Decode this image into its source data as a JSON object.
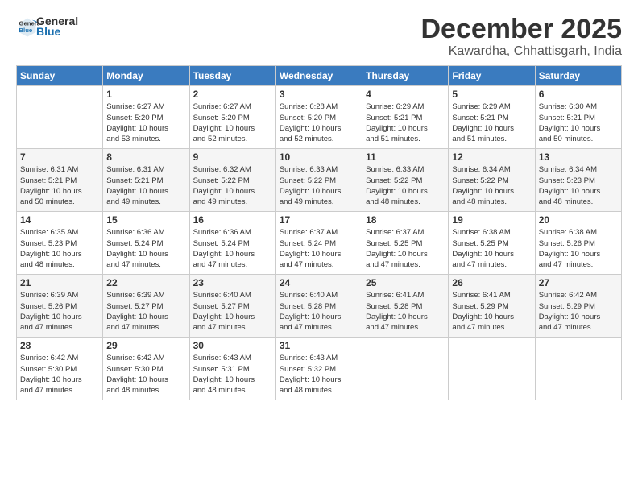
{
  "logo": {
    "line1": "General",
    "line2": "Blue"
  },
  "title": "December 2025",
  "location": "Kawardha, Chhattisgarh, India",
  "days_of_week": [
    "Sunday",
    "Monday",
    "Tuesday",
    "Wednesday",
    "Thursday",
    "Friday",
    "Saturday"
  ],
  "weeks": [
    [
      {
        "day": "",
        "info": ""
      },
      {
        "day": "1",
        "info": "Sunrise: 6:27 AM\nSunset: 5:20 PM\nDaylight: 10 hours\nand 53 minutes."
      },
      {
        "day": "2",
        "info": "Sunrise: 6:27 AM\nSunset: 5:20 PM\nDaylight: 10 hours\nand 52 minutes."
      },
      {
        "day": "3",
        "info": "Sunrise: 6:28 AM\nSunset: 5:20 PM\nDaylight: 10 hours\nand 52 minutes."
      },
      {
        "day": "4",
        "info": "Sunrise: 6:29 AM\nSunset: 5:21 PM\nDaylight: 10 hours\nand 51 minutes."
      },
      {
        "day": "5",
        "info": "Sunrise: 6:29 AM\nSunset: 5:21 PM\nDaylight: 10 hours\nand 51 minutes."
      },
      {
        "day": "6",
        "info": "Sunrise: 6:30 AM\nSunset: 5:21 PM\nDaylight: 10 hours\nand 50 minutes."
      }
    ],
    [
      {
        "day": "7",
        "info": "Sunrise: 6:31 AM\nSunset: 5:21 PM\nDaylight: 10 hours\nand 50 minutes."
      },
      {
        "day": "8",
        "info": "Sunrise: 6:31 AM\nSunset: 5:21 PM\nDaylight: 10 hours\nand 49 minutes."
      },
      {
        "day": "9",
        "info": "Sunrise: 6:32 AM\nSunset: 5:22 PM\nDaylight: 10 hours\nand 49 minutes."
      },
      {
        "day": "10",
        "info": "Sunrise: 6:33 AM\nSunset: 5:22 PM\nDaylight: 10 hours\nand 49 minutes."
      },
      {
        "day": "11",
        "info": "Sunrise: 6:33 AM\nSunset: 5:22 PM\nDaylight: 10 hours\nand 48 minutes."
      },
      {
        "day": "12",
        "info": "Sunrise: 6:34 AM\nSunset: 5:22 PM\nDaylight: 10 hours\nand 48 minutes."
      },
      {
        "day": "13",
        "info": "Sunrise: 6:34 AM\nSunset: 5:23 PM\nDaylight: 10 hours\nand 48 minutes."
      }
    ],
    [
      {
        "day": "14",
        "info": "Sunrise: 6:35 AM\nSunset: 5:23 PM\nDaylight: 10 hours\nand 48 minutes."
      },
      {
        "day": "15",
        "info": "Sunrise: 6:36 AM\nSunset: 5:24 PM\nDaylight: 10 hours\nand 47 minutes."
      },
      {
        "day": "16",
        "info": "Sunrise: 6:36 AM\nSunset: 5:24 PM\nDaylight: 10 hours\nand 47 minutes."
      },
      {
        "day": "17",
        "info": "Sunrise: 6:37 AM\nSunset: 5:24 PM\nDaylight: 10 hours\nand 47 minutes."
      },
      {
        "day": "18",
        "info": "Sunrise: 6:37 AM\nSunset: 5:25 PM\nDaylight: 10 hours\nand 47 minutes."
      },
      {
        "day": "19",
        "info": "Sunrise: 6:38 AM\nSunset: 5:25 PM\nDaylight: 10 hours\nand 47 minutes."
      },
      {
        "day": "20",
        "info": "Sunrise: 6:38 AM\nSunset: 5:26 PM\nDaylight: 10 hours\nand 47 minutes."
      }
    ],
    [
      {
        "day": "21",
        "info": "Sunrise: 6:39 AM\nSunset: 5:26 PM\nDaylight: 10 hours\nand 47 minutes."
      },
      {
        "day": "22",
        "info": "Sunrise: 6:39 AM\nSunset: 5:27 PM\nDaylight: 10 hours\nand 47 minutes."
      },
      {
        "day": "23",
        "info": "Sunrise: 6:40 AM\nSunset: 5:27 PM\nDaylight: 10 hours\nand 47 minutes."
      },
      {
        "day": "24",
        "info": "Sunrise: 6:40 AM\nSunset: 5:28 PM\nDaylight: 10 hours\nand 47 minutes."
      },
      {
        "day": "25",
        "info": "Sunrise: 6:41 AM\nSunset: 5:28 PM\nDaylight: 10 hours\nand 47 minutes."
      },
      {
        "day": "26",
        "info": "Sunrise: 6:41 AM\nSunset: 5:29 PM\nDaylight: 10 hours\nand 47 minutes."
      },
      {
        "day": "27",
        "info": "Sunrise: 6:42 AM\nSunset: 5:29 PM\nDaylight: 10 hours\nand 47 minutes."
      }
    ],
    [
      {
        "day": "28",
        "info": "Sunrise: 6:42 AM\nSunset: 5:30 PM\nDaylight: 10 hours\nand 47 minutes."
      },
      {
        "day": "29",
        "info": "Sunrise: 6:42 AM\nSunset: 5:30 PM\nDaylight: 10 hours\nand 48 minutes."
      },
      {
        "day": "30",
        "info": "Sunrise: 6:43 AM\nSunset: 5:31 PM\nDaylight: 10 hours\nand 48 minutes."
      },
      {
        "day": "31",
        "info": "Sunrise: 6:43 AM\nSunset: 5:32 PM\nDaylight: 10 hours\nand 48 minutes."
      },
      {
        "day": "",
        "info": ""
      },
      {
        "day": "",
        "info": ""
      },
      {
        "day": "",
        "info": ""
      }
    ]
  ]
}
